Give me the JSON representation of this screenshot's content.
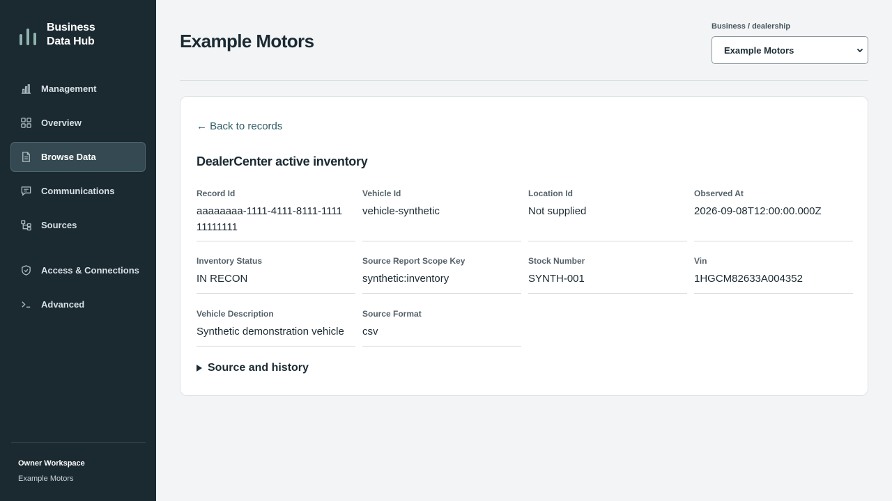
{
  "brand": {
    "line1": "Business",
    "line2": "Data Hub"
  },
  "nav": [
    {
      "label": "Management",
      "icon": "bar-chart-icon"
    },
    {
      "label": "Overview",
      "icon": "grid-icon"
    },
    {
      "label": "Browse Data",
      "icon": "document-icon",
      "active": true
    },
    {
      "label": "Communications",
      "icon": "message-icon"
    },
    {
      "label": "Sources",
      "icon": "sources-icon"
    },
    {
      "label": "Access & Connections",
      "icon": "shield-icon"
    },
    {
      "label": "Advanced",
      "icon": "terminal-icon"
    }
  ],
  "workspace": {
    "title": "Owner Workspace",
    "name": "Example Motors"
  },
  "header": {
    "title": "Example Motors",
    "business_label": "Business / dealership",
    "business_selected": "Example Motors"
  },
  "record": {
    "back_label": "← Back to records",
    "title": "DealerCenter active inventory",
    "fields": [
      {
        "label": "Record Id",
        "value": "aaaaaaaa-1111-4111-8111-111111111111"
      },
      {
        "label": "Vehicle Id",
        "value": "vehicle-synthetic"
      },
      {
        "label": "Location Id",
        "value": "Not supplied"
      },
      {
        "label": "Observed At",
        "value": "2026-09-08T12:00:00.000Z"
      },
      {
        "label": "Inventory Status",
        "value": "IN RECON"
      },
      {
        "label": "Source Report Scope Key",
        "value": "synthetic:inventory"
      },
      {
        "label": "Stock Number",
        "value": "SYNTH-001"
      },
      {
        "label": "Vin",
        "value": "1HGCM82633A004352"
      },
      {
        "label": "Vehicle Description",
        "value": "Synthetic demonstration vehicle"
      },
      {
        "label": "Source Format",
        "value": "csv"
      }
    ],
    "details_label": "Source and history"
  },
  "colors": {
    "sidebar_bg": "#1b2931",
    "active_item_bg": "#344951",
    "accent_link": "#2f5b66",
    "page_bg": "#f3f4f6"
  }
}
